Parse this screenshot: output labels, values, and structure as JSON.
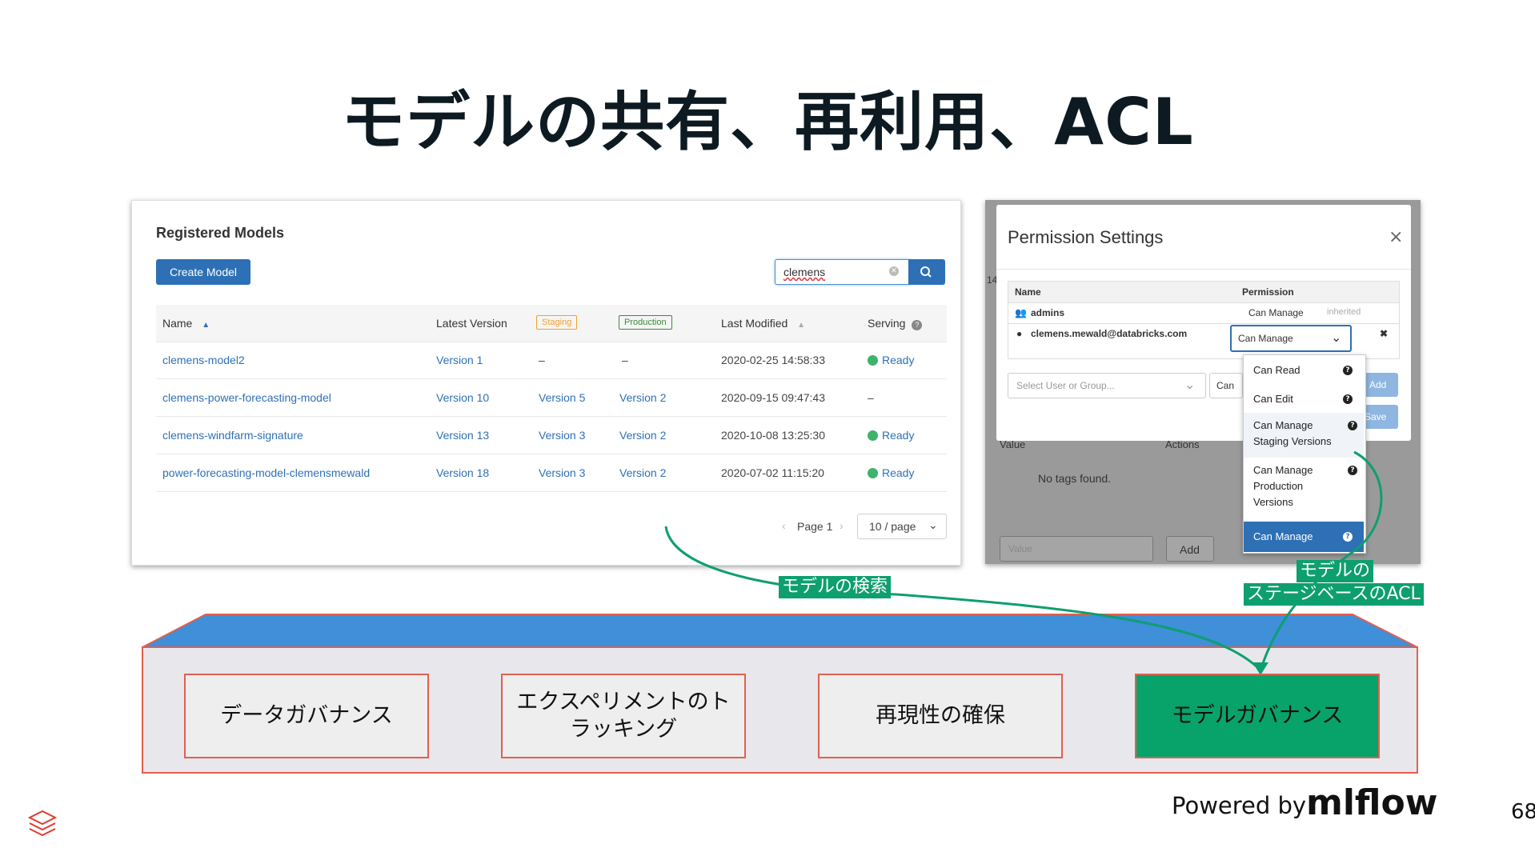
{
  "slide": {
    "title": "モデルの共有、再利用、ACL",
    "page_number": "68",
    "powered_by": "Powered by",
    "logo_text": "mlflow"
  },
  "registered_models": {
    "title": "Registered Models",
    "create_button": "Create Model",
    "search_value": "clemens",
    "columns": {
      "name": "Name",
      "latest_version": "Latest Version",
      "staging": "Staging",
      "production": "Production",
      "last_modified": "Last Modified",
      "serving": "Serving"
    },
    "rows": [
      {
        "name": "clemens-model2",
        "latest": "Version 1",
        "staging": "–",
        "production": "–",
        "modified": "2020-02-25 14:58:33",
        "serving": "Ready"
      },
      {
        "name": "clemens-power-forecasting-model",
        "latest": "Version 10",
        "staging": "Version 5",
        "production": "Version 2",
        "modified": "2020-09-15 09:47:43",
        "serving": "–"
      },
      {
        "name": "clemens-windfarm-signature",
        "latest": "Version 13",
        "staging": "Version 3",
        "production": "Version 2",
        "modified": "2020-10-08 13:25:30",
        "serving": "Ready"
      },
      {
        "name": "power-forecasting-model-clemensmewald",
        "latest": "Version 18",
        "staging": "Version 3",
        "production": "Version 2",
        "modified": "2020-07-02 11:15:20",
        "serving": "Ready"
      }
    ],
    "pager": {
      "page": "Page 1",
      "per_page": "10 / page"
    }
  },
  "permissions": {
    "title": "Permission Settings",
    "col_name": "Name",
    "col_permission": "Permission",
    "rows": [
      {
        "name": "admins",
        "permission": "Can Manage",
        "note": "inherited"
      },
      {
        "name": "clemens.mewald@databricks.com",
        "permission": "Can Manage"
      }
    ],
    "user_placeholder": "Select User or Group...",
    "perm_partial": "Can",
    "add_button": "Add",
    "save_button": "Save",
    "dropdown": [
      "Can Read",
      "Can Edit",
      "Can Manage Staging Versions",
      "Can Manage Production Versions",
      "Can Manage"
    ],
    "dropdown_lines": {
      "staging_1": "Can Manage",
      "staging_2": "Staging Versions",
      "prod_1": "Can Manage",
      "prod_2": "Production",
      "prod_3": "Versions"
    },
    "bg_value": "Value",
    "bg_actions": "Actions",
    "bg_no_tags": "No tags found.",
    "bg_value_input": "Value",
    "bg_add": "Add",
    "bg_partial": "14"
  },
  "callouts": {
    "search": "モデルの検索",
    "acl_line1": "モデルの",
    "acl_line2": "ステージベースのACL"
  },
  "platform": {
    "boxes": [
      {
        "label": "データガバナンス"
      },
      {
        "label_1": "エクスペリメントのト",
        "label_2": "ラッキング"
      },
      {
        "label": "再現性の確保"
      },
      {
        "label": "モデルガバナンス"
      }
    ]
  },
  "colors": {
    "accent_blue": "#2e70b5",
    "callout_green": "#0e9f6e",
    "platform_top": "#3f8fd9",
    "box_border": "#e06050",
    "governance_green": "#07a36b"
  }
}
